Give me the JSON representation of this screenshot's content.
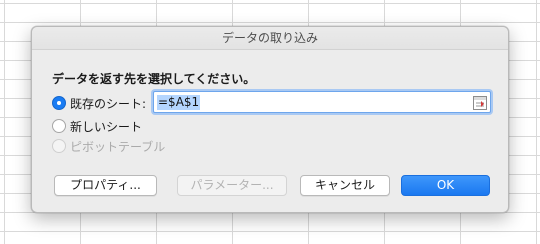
{
  "dialog": {
    "title": "データの取り込み",
    "prompt": "データを返す先を選択してください。",
    "options": {
      "existing_sheet": {
        "label": "既存のシート:",
        "selected": true,
        "enabled": true
      },
      "new_sheet": {
        "label": "新しいシート",
        "selected": false,
        "enabled": true
      },
      "pivot_table": {
        "label": "ピボットテーブル",
        "selected": false,
        "enabled": false
      }
    },
    "reference_field": {
      "value": "=$A$1"
    },
    "buttons": {
      "properties": "プロパティ...",
      "parameters": "パラメーター...",
      "cancel": "キャンセル",
      "ok": "OK"
    }
  },
  "colors": {
    "accent": "#1a7cf3",
    "selection": "#b4d5fe",
    "dialog_bg": "#ececec"
  },
  "icons": {
    "ref_picker": "collapse-dialog-icon"
  }
}
